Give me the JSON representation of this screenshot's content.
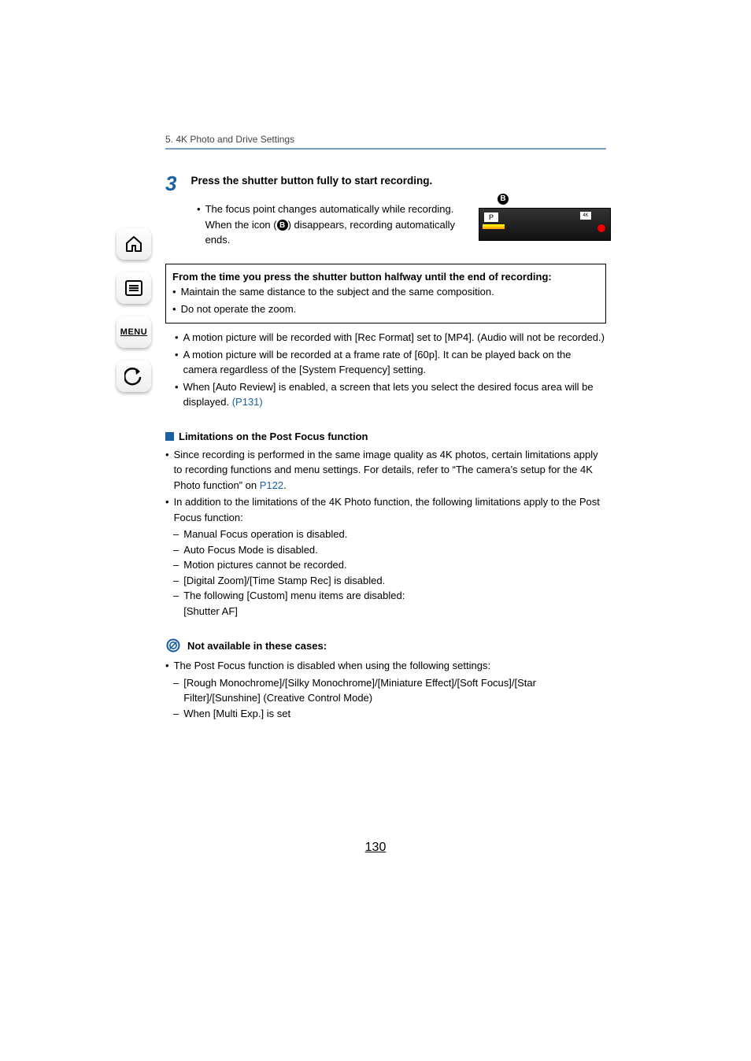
{
  "breadcrumb": "5. 4K Photo and Drive Settings",
  "sidebar": {
    "menu_label": "MENU"
  },
  "step": {
    "number": "3",
    "title": "Press the shutter button fully to start recording.",
    "bullet1_a": "The focus point changes automatically while recording. When the icon (",
    "bullet1_icon": "B",
    "bullet1_b": ") disappears, recording automatically ends."
  },
  "thumb": {
    "label": "B",
    "p": "P",
    "fourk": "4K"
  },
  "box": {
    "title": "From the time you press the shutter button halfway until the end of recording:",
    "line1": "Maintain the same distance to the subject and the same composition.",
    "line2": "Do not operate the zoom."
  },
  "after_box": {
    "b1": "A motion picture will be recorded with [Rec Format] set to [MP4]. (Audio will not be recorded.)",
    "b2": "A motion picture will be recorded at a frame rate of [60p]. It can be played back on the camera regardless of the [System Frequency] setting.",
    "b3_a": "When [Auto Review] is enabled, a screen that lets you select the desired focus area will be displayed. ",
    "b3_link": "(P131)"
  },
  "limitations": {
    "heading": "Limitations on the Post Focus function",
    "p1_a": "Since recording is performed in the same image quality as 4K photos, certain limitations apply to recording functions and menu settings. For details, refer to “The camera’s setup for the 4K Photo function” on ",
    "p1_link": "P122",
    "p1_b": ".",
    "p2": "In addition to the limitations of the 4K Photo function, the following limitations apply to the Post Focus function:",
    "d1": "Manual Focus operation is disabled.",
    "d2": "Auto Focus Mode is disabled.",
    "d3": "Motion pictures cannot be recorded.",
    "d4": "[Digital Zoom]/[Time Stamp Rec] is disabled.",
    "d5": "The following [Custom] menu items are disabled:",
    "d5b": "[Shutter AF]"
  },
  "not_available": {
    "heading": "Not available in these cases:",
    "p1": "The Post Focus function is disabled when using the following settings:",
    "d1": "[Rough Monochrome]/[Silky Monochrome]/[Miniature Effect]/[Soft Focus]/[Star Filter]/[Sunshine] (Creative Control Mode)",
    "d2": "When [Multi Exp.] is set"
  },
  "page": "130"
}
